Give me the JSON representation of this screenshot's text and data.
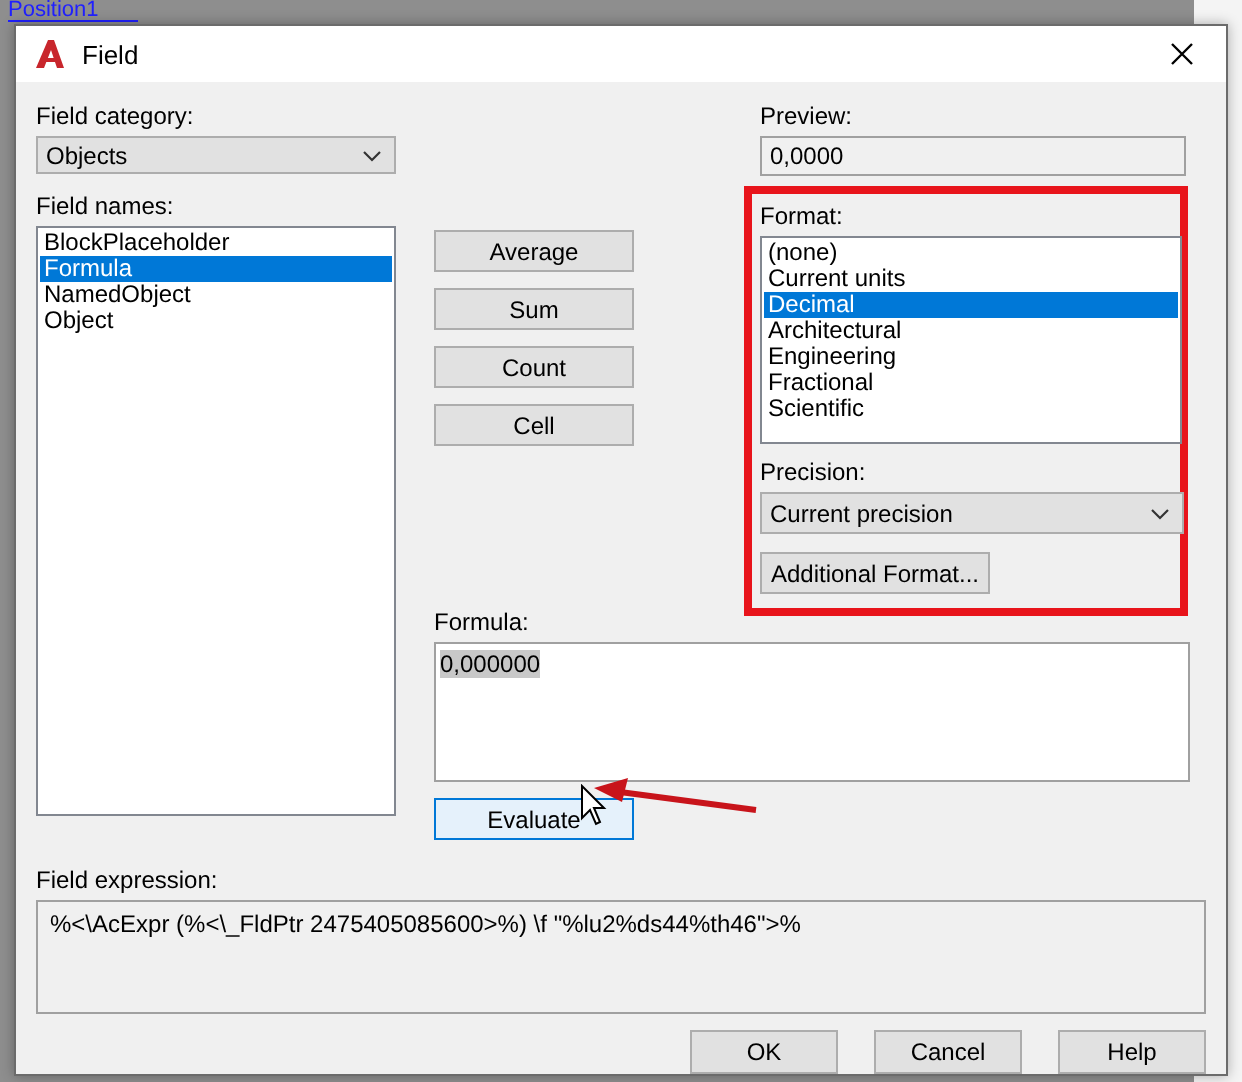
{
  "background_label": "Position1",
  "window": {
    "title": "Field"
  },
  "field_category": {
    "label": "Field category:",
    "value": "Objects"
  },
  "field_names": {
    "label": "Field names:",
    "items": [
      {
        "label": "BlockPlaceholder",
        "selected": false
      },
      {
        "label": "Formula",
        "selected": true
      },
      {
        "label": "NamedObject",
        "selected": false
      },
      {
        "label": "Object",
        "selected": false
      }
    ]
  },
  "function_buttons": [
    "Average",
    "Sum",
    "Count",
    "Cell"
  ],
  "preview": {
    "label": "Preview:",
    "value": "0,0000"
  },
  "format": {
    "label": "Format:",
    "items": [
      {
        "label": "(none)",
        "selected": false
      },
      {
        "label": "Current units",
        "selected": false
      },
      {
        "label": "Decimal",
        "selected": true
      },
      {
        "label": "Architectural",
        "selected": false
      },
      {
        "label": "Engineering",
        "selected": false
      },
      {
        "label": "Fractional",
        "selected": false
      },
      {
        "label": "Scientific",
        "selected": false
      }
    ]
  },
  "precision": {
    "label": "Precision:",
    "value": "Current precision"
  },
  "additional_format_button": "Additional Format...",
  "formula": {
    "label": "Formula:",
    "value": "0,000000",
    "text_selected": true
  },
  "evaluate_button": {
    "label": "Evaluate",
    "focused": true
  },
  "field_expression": {
    "label": "Field expression:",
    "value": "%<\\AcExpr (%<\\_FldPtr 2475405085600>%) \\f \"%lu2%ds44%th46\">%"
  },
  "buttons": [
    "OK",
    "Cancel",
    "Help"
  ]
}
